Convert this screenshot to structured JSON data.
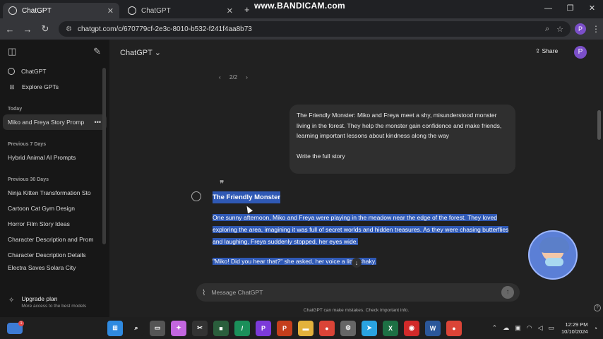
{
  "browser": {
    "tabs": [
      {
        "label": "ChatGPT",
        "close": "✕"
      },
      {
        "label": "ChatGPT",
        "close": "✕"
      }
    ],
    "new_tab": "+",
    "watermark": "www.BANDICAM.com",
    "window_controls": [
      "—",
      "❐",
      "✕"
    ],
    "url": "chatgpt.com/c/670779cf-2e3c-8010-b532-f241f4aa8b73",
    "profile_initial": "P"
  },
  "sidebar": {
    "top_items": [
      {
        "label": "ChatGPT",
        "icon": "openai-logo-icon"
      },
      {
        "label": "Explore GPTs",
        "icon": "grid-icon"
      }
    ],
    "sections": [
      {
        "heading": "Today",
        "items": [
          "Miko and Freya Story Promp"
        ]
      },
      {
        "heading": "Previous 7 Days",
        "items": [
          "Hybrid Animal AI Prompts"
        ]
      },
      {
        "heading": "Previous 30 Days",
        "items": [
          "Ninja Kitten Transformation Sto",
          "Cartoon Cat Gym Design",
          "Horror Film Story Ideas",
          "Character Description and Prom",
          "Character Description Details",
          "Electra Saves Solara City"
        ]
      }
    ],
    "upgrade": {
      "title": "Upgrade plan",
      "subtitle": "More access to the best models"
    }
  },
  "header": {
    "model": "ChatGPT",
    "model_chevron": "⌄",
    "share_label": "Share",
    "avatar_initial": "P"
  },
  "conversation": {
    "pager": {
      "prev": "‹",
      "label": "2/2",
      "next": "›"
    },
    "user_message": {
      "text": "The Friendly Monster: Miko and Freya meet a shy, misunderstood monster living in the forest. They help the monster gain confidence and make friends, learning important lessons about kindness along the way",
      "followup": "Write the full story"
    },
    "assistant": {
      "title": "The Friendly Monster",
      "paragraphs": [
        "One sunny afternoon, Miko and Freya were playing in the meadow near the edge of the forest. They loved exploring the area, imagining it was full of secret worlds and hidden treasures. As they were chasing butterflies and laughing, Freya suddenly stopped, her eyes wide.",
        "\"Miko! Did you hear that?\" she asked, her voice a little shaky."
      ]
    }
  },
  "composer": {
    "placeholder": "Message ChatGPT",
    "disclaimer": "ChatGPT can make mistakes. Check important info."
  },
  "taskbar": {
    "weather_badge": "1",
    "apps": [
      {
        "icon": "windows-start-icon",
        "color": "#2f8ae0",
        "glyph": "⊞"
      },
      {
        "icon": "search-icon",
        "color": "#1f1f1f",
        "glyph": "⌕"
      },
      {
        "icon": "task-view-icon",
        "color": "#555555",
        "glyph": "▭"
      },
      {
        "icon": "copilot-icon",
        "color": "#c467e0",
        "glyph": "✦"
      },
      {
        "icon": "capcut-icon",
        "color": "#333333",
        "glyph": "✂"
      },
      {
        "icon": "app-icon",
        "color": "#2a5e3c",
        "glyph": "■"
      },
      {
        "icon": "app-icon",
        "color": "#1b8f5a",
        "glyph": "/"
      },
      {
        "icon": "picsart-icon",
        "color": "#7c3ad9",
        "glyph": "P"
      },
      {
        "icon": "powerpoint-icon",
        "color": "#c43e1c",
        "glyph": "P"
      },
      {
        "icon": "file-explorer-icon",
        "color": "#e3b23c",
        "glyph": "▬"
      },
      {
        "icon": "chrome-icon",
        "color": "#db4437",
        "glyph": "●"
      },
      {
        "icon": "settings-icon",
        "color": "#666666",
        "glyph": "⚙"
      },
      {
        "icon": "telegram-icon",
        "color": "#2aa3e0",
        "glyph": "➤"
      },
      {
        "icon": "excel-icon",
        "color": "#1d7044",
        "glyph": "X"
      },
      {
        "icon": "bandicam-icon",
        "color": "#d12a2a",
        "glyph": "◉"
      },
      {
        "icon": "word-icon",
        "color": "#2b579a",
        "glyph": "W"
      },
      {
        "icon": "chrome-icon",
        "color": "#db4437",
        "glyph": "●"
      }
    ],
    "time": "12:29 PM",
    "date": "10/10/2024"
  },
  "colors": {
    "selection": "#2f59b5",
    "sidebar_bg": "#171717",
    "main_bg": "#212121",
    "accent_purple": "#7b4fc9"
  }
}
